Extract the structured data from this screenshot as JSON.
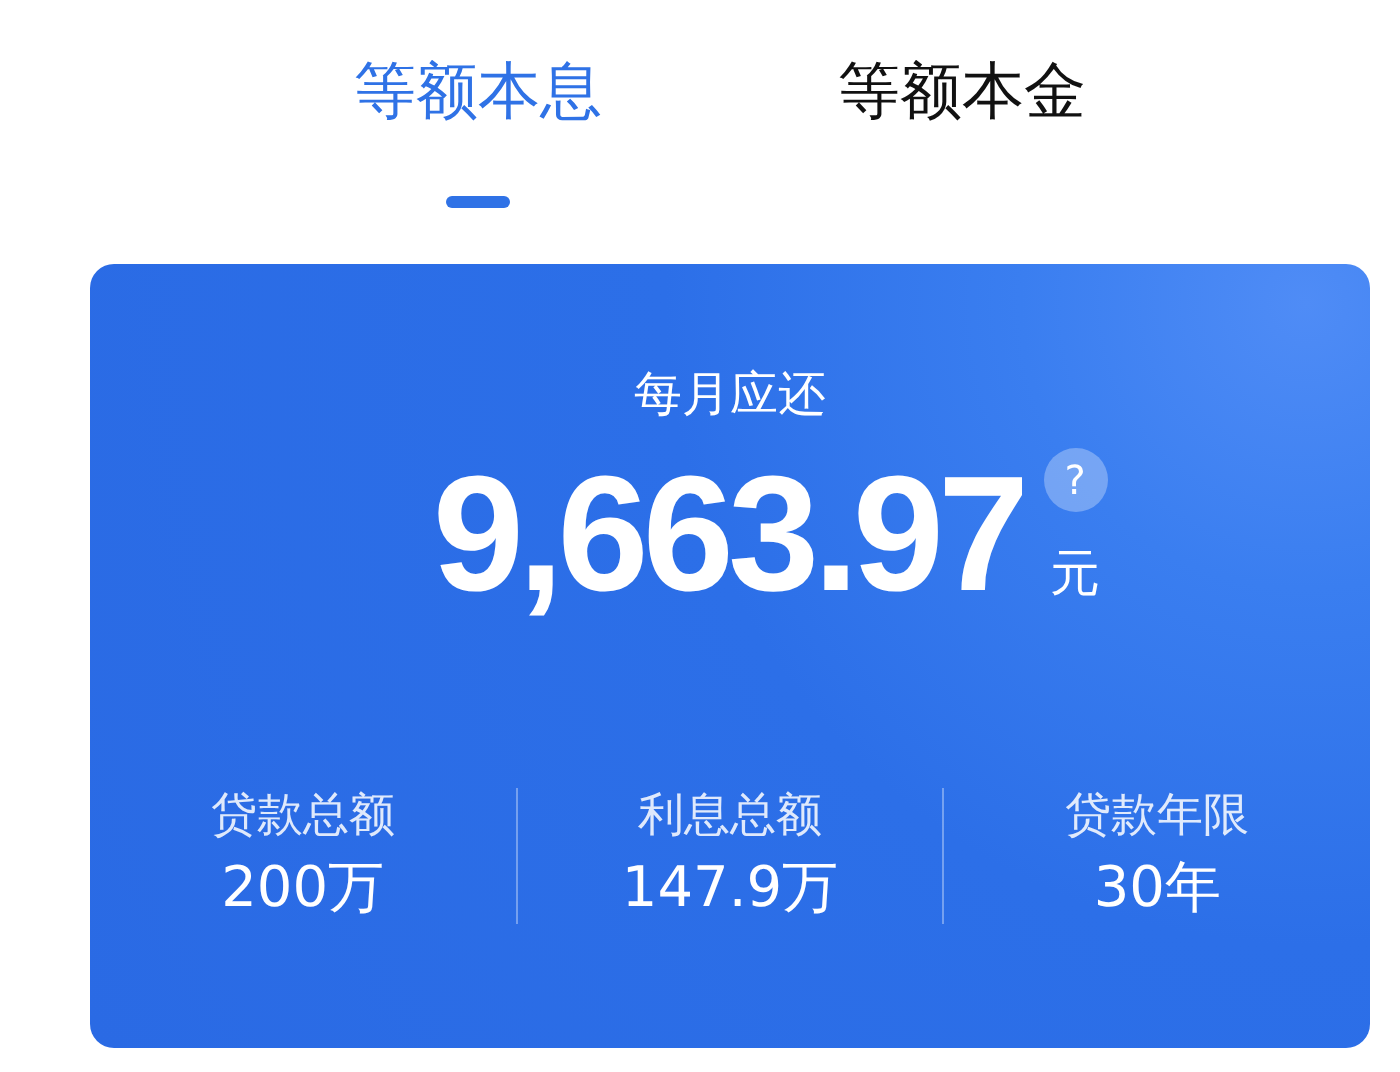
{
  "tabs": [
    {
      "label": "等额本息",
      "selected": true
    },
    {
      "label": "等额本金",
      "selected": false
    }
  ],
  "summary": {
    "label": "每月应还",
    "amount": "9,663.97",
    "help": "?",
    "unit": "元"
  },
  "stats": [
    {
      "label": "贷款总额",
      "value": "200万"
    },
    {
      "label": "利息总额",
      "value": "147.9万"
    },
    {
      "label": "贷款年限",
      "value": "30年"
    }
  ]
}
